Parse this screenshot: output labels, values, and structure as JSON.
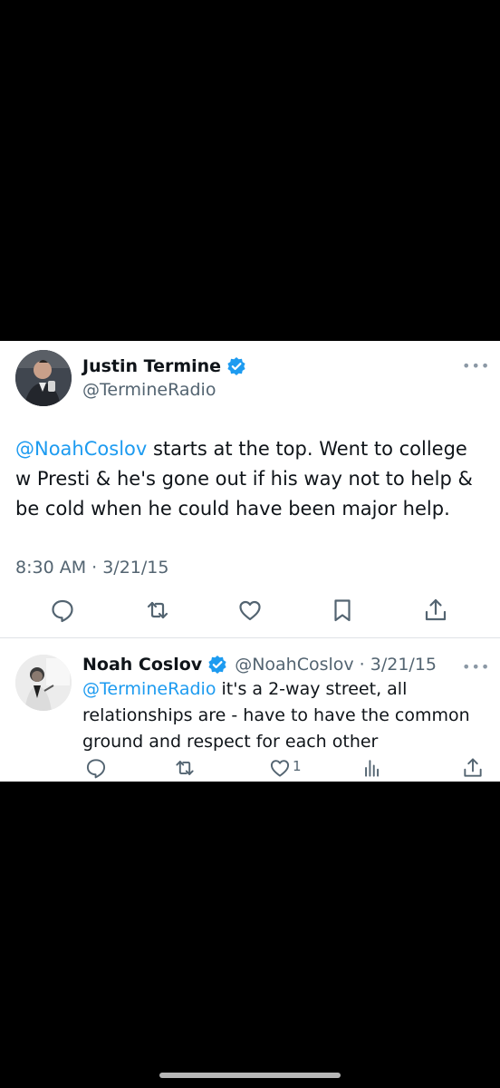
{
  "main_tweet": {
    "author_name": "Justin Termine",
    "handle": "@TermineRadio",
    "text_mention": "@NoahCoslov",
    "text_rest": " starts at the top. Went to college w Presti & he's gone out if his way not to help & be cold when he could have been major help.",
    "timestamp": "8:30 AM · 3/21/15",
    "icons": [
      "reply-icon",
      "retweet-icon",
      "like-icon",
      "bookmark-icon",
      "share-icon"
    ]
  },
  "reply_tweet": {
    "author_name": "Noah Coslov",
    "handle_date": "@NoahCoslov · 3/21/15",
    "text_mention": "@TermineRadio",
    "text_rest": " it's a 2-way street, all relationships are - have to have the common ground and respect for each other",
    "like_count": "1",
    "icons": [
      "reply-icon",
      "retweet-icon",
      "like-icon",
      "views-icon",
      "share-icon"
    ]
  },
  "colors": {
    "background": "#000000",
    "card": "#ffffff",
    "link": "#1d9bf0",
    "text": "#0f1419",
    "secondary": "#536471",
    "verified": "#1d9bf0"
  }
}
